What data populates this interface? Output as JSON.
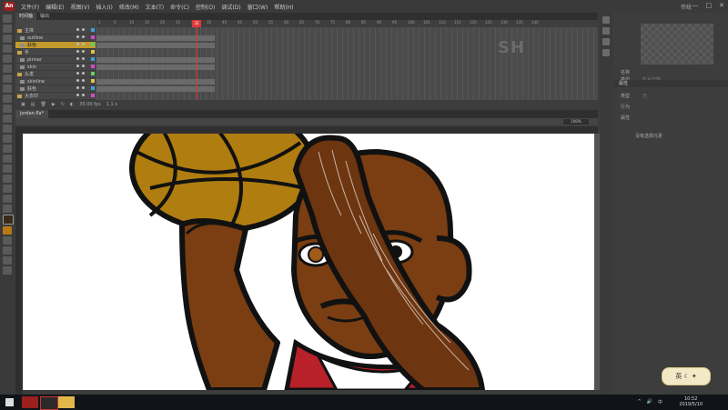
{
  "app": {
    "logo_text": "An"
  },
  "menubar": {
    "items": [
      "文件(F)",
      "编辑(E)",
      "视图(V)",
      "插入(I)",
      "修改(M)",
      "文本(T)",
      "命令(C)",
      "控制(O)",
      "调试(D)",
      "窗口(W)",
      "帮助(H)"
    ],
    "workspace_label": "传统",
    "window_controls": [
      "—",
      "□",
      "✕"
    ]
  },
  "timeline": {
    "tabs": [
      "时间轴",
      "输出"
    ],
    "layers": [
      {
        "name": "主体",
        "type": "folder"
      },
      {
        "name": "outline",
        "type": "layer"
      },
      {
        "name": "肤色",
        "type": "layer",
        "selected": true
      },
      {
        "name": "手",
        "type": "folder"
      },
      {
        "name": "pinner",
        "type": "layer"
      },
      {
        "name": "skin",
        "type": "layer"
      },
      {
        "name": "头发",
        "type": "folder"
      },
      {
        "name": "skinline",
        "type": "layer"
      },
      {
        "name": "肤色",
        "type": "layer"
      },
      {
        "name": "大衣印",
        "type": "folder"
      }
    ],
    "ruler_ticks": [
      "1",
      "5",
      "10",
      "15",
      "20",
      "25",
      "30",
      "35",
      "40",
      "45",
      "50",
      "55",
      "60",
      "65",
      "70",
      "75",
      "80",
      "85",
      "90",
      "95",
      "100",
      "105",
      "110",
      "115",
      "120",
      "125",
      "130",
      "135",
      "140"
    ],
    "current_frame": "32",
    "bottom_status": [
      "30.00 fps",
      "1.1 s"
    ],
    "watermark": "SH"
  },
  "document": {
    "tab_label": "jordan.fla*",
    "zoom": "100%",
    "colors": {
      "stage_bg": "#ffffff",
      "skin": "#7a3e12",
      "ball": "#b07d10",
      "jersey": "#b8202a",
      "outline": "#111111"
    }
  },
  "properties": {
    "rows": [
      {
        "label": "名称",
        "value": ""
      },
      {
        "label": "类型",
        "value": "影片剪辑"
      },
      {
        "label": "类型",
        "value": "无"
      },
      {
        "label": "行为",
        "value": ""
      },
      {
        "label": "属性",
        "value": ""
      }
    ],
    "section_title": "属性",
    "note": "没有选择元素"
  },
  "taskbar": {
    "time": "10:52",
    "date": "2019/5/10",
    "tray": [
      "^",
      "🔊",
      "中"
    ],
    "ime_label": "英 ☾ ✦"
  }
}
